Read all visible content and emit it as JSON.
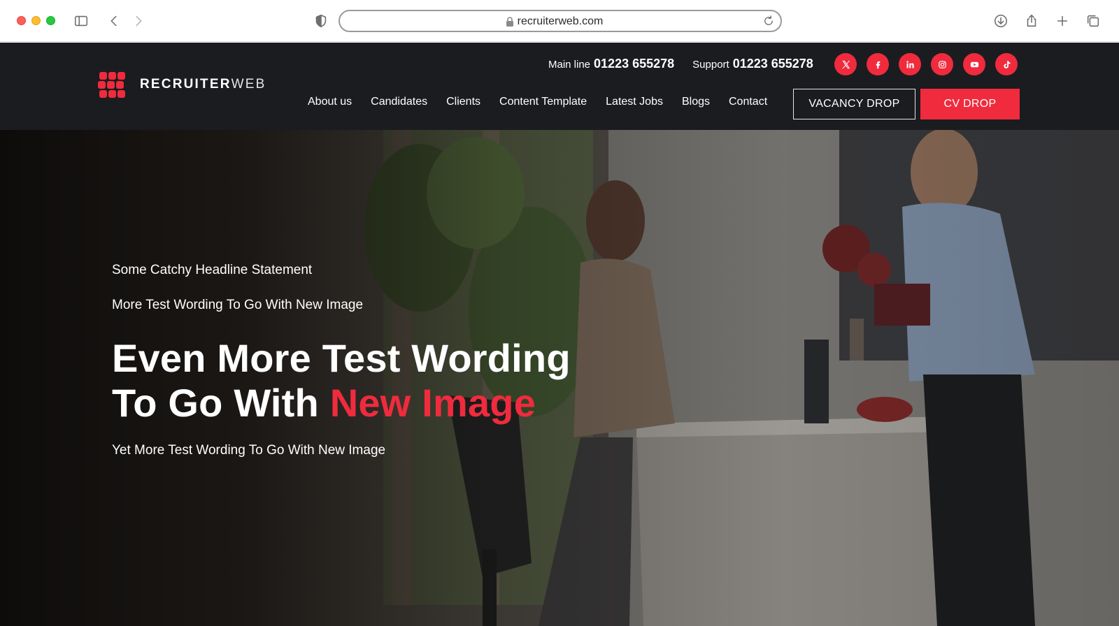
{
  "browser": {
    "url": "recruiterweb.com"
  },
  "site": {
    "logo": {
      "text_bold": "RECRUITER",
      "text_light": "WEB"
    },
    "contacts": [
      {
        "label": "Main line",
        "number": "01223 655278"
      },
      {
        "label": "Support",
        "number": "01223 655278"
      }
    ],
    "socials": [
      "x-icon",
      "facebook-icon",
      "linkedin-icon",
      "instagram-icon",
      "youtube-icon",
      "tiktok-icon"
    ],
    "nav": [
      "About us",
      "Candidates",
      "Clients",
      "Content Template",
      "Latest Jobs",
      "Blogs",
      "Contact"
    ],
    "buttons": {
      "vacancy": "VACANCY DROP",
      "cv": "CV DROP"
    },
    "accent_color": "#ef2b3d",
    "header_bg": "#1b1c20"
  },
  "hero": {
    "kicker": "Some Catchy Headline Statement",
    "sub1": "More Test Wording To Go With New Image",
    "headline_line1": "Even More Test Wording",
    "headline_line2_prefix": "To Go With ",
    "headline_line2_accent": "New Image",
    "sub2": "Yet More Test Wording To Go With New Image"
  }
}
